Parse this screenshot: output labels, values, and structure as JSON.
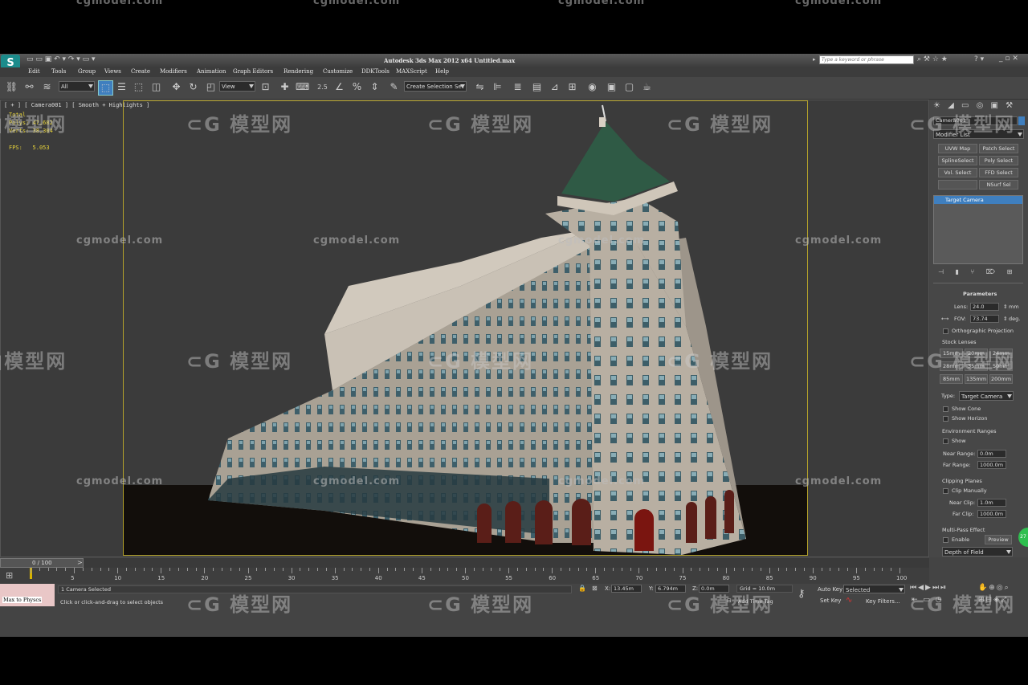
{
  "watermarks": {
    "site": "cgmodel.com",
    "logo": "模型网"
  },
  "window": {
    "title": "Autodesk 3ds Max  2012 x64      Untitled.max",
    "search_placeholder": "Type a keyword or phrase"
  },
  "menu": [
    "Edit",
    "Tools",
    "Group",
    "Views",
    "Create",
    "Modifiers",
    "Animation",
    "Graph Editors",
    "Rendering",
    "Customize",
    "DDKTools",
    "MAXScript",
    "Help"
  ],
  "toolbar": {
    "filter_value": "All",
    "refcoord_value": "View",
    "selection_set_value": "Create Selection Set",
    "snap_label": "2.5"
  },
  "viewport": {
    "label": "[ + ] [ Camera001 ] [ Smooth + Highlights ]",
    "stats": {
      "total_label": "Total",
      "polys_label": "Polys:",
      "polys_value": "47,682",
      "verts_label": "Verts:",
      "verts_value": "38,304",
      "fps_label": "FPS:",
      "fps_value": "5.053"
    }
  },
  "command_panel": {
    "object_name": "Camera001",
    "modifier_list": "Modifier List",
    "modifier_buttons": [
      "UVW Map",
      "Patch Select",
      "SplineSelect",
      "Poly Select",
      "Vol. Select",
      "FFD Select",
      "",
      "NSurf Sel"
    ],
    "stack_item": "Target Camera",
    "rollout_title": "Parameters",
    "lens_label": "Lens:",
    "lens_value": "24.0",
    "lens_unit": "mm",
    "fov_label": "FOV:",
    "fov_value": "73.74",
    "fov_unit": "deg.",
    "ortho_label": "Orthographic Projection",
    "stock_lenses_label": "Stock Lenses",
    "stock_lenses": [
      "15mm",
      "20mm",
      "24mm",
      "28mm",
      "35mm",
      "50mm",
      "85mm",
      "135mm",
      "200mm"
    ],
    "type_label": "Type:",
    "type_value": "Target Camera",
    "show_cone": "Show Cone",
    "show_horizon": "Show Horizon",
    "env_ranges": "Environment Ranges",
    "env_show": "Show",
    "near_range_label": "Near Range:",
    "near_range_value": "0.0m",
    "far_range_label": "Far Range:",
    "far_range_value": "1000.0m",
    "clipping_planes": "Clipping Planes",
    "clip_manually": "Clip Manually",
    "near_clip_label": "Near Clip:",
    "near_clip_value": "1.0m",
    "far_clip_label": "Far Clip:",
    "far_clip_value": "1000.0m",
    "multipass": "Multi-Pass Effect",
    "enable": "Enable",
    "preview": "Preview",
    "effect_value": "Depth of Field",
    "badge": "27"
  },
  "timeline": {
    "slider_label": "0 / 100",
    "ticks": [
      "5",
      "10",
      "15",
      "20",
      "25",
      "30",
      "35",
      "40",
      "45",
      "50",
      "55",
      "60",
      "65",
      "70",
      "75",
      "80",
      "85",
      "90",
      "95",
      "100"
    ]
  },
  "status": {
    "script_label": "Max to Physcs",
    "selected": "1 Camera Selected",
    "prompt": "Click or click-and-drag to select objects",
    "x_label": "X:",
    "x_value": "13.45m",
    "y_label": "Y:",
    "y_value": "6.794m",
    "z_label": "Z:",
    "z_value": "0.0m",
    "grid": "Grid = 10.0m",
    "add_time_tag": "Add Time Tag",
    "auto_key": "Auto Key",
    "selected_dd": "Selected",
    "set_key": "Set Key",
    "key_filters": "Key Filters..."
  },
  "colors": {
    "accent_yellow": "#b3a12a",
    "ui_bg": "#444444",
    "viewport_bg": "#3b3b3b"
  }
}
